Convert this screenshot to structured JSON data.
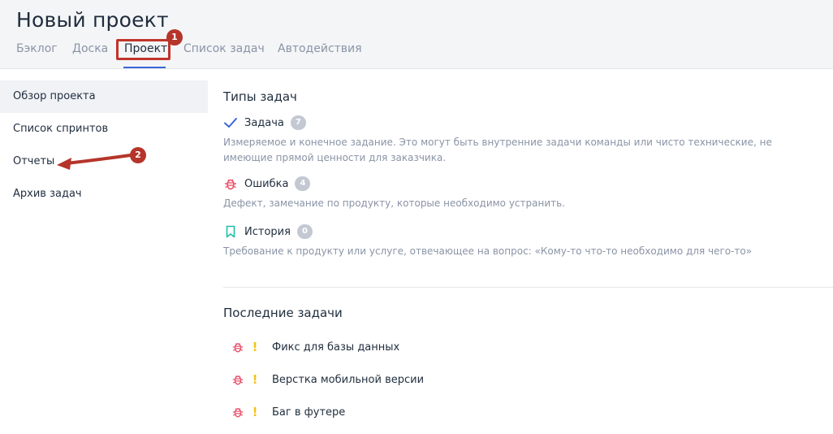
{
  "header": {
    "title": "Новый проект",
    "tabs": [
      {
        "label": "Бэклог"
      },
      {
        "label": "Доска"
      },
      {
        "label": "Проект"
      },
      {
        "label": "Список задач"
      },
      {
        "label": "Автодействия"
      }
    ],
    "active_tab": "Проект"
  },
  "sidebar": {
    "items": [
      {
        "label": "Обзор проекта"
      },
      {
        "label": "Список спринтов"
      },
      {
        "label": "Отчеты"
      },
      {
        "label": "Архив задач"
      }
    ],
    "active_item": "Обзор проекта"
  },
  "task_types": {
    "title": "Типы задач",
    "items": [
      {
        "icon": "check-icon",
        "name": "Задача",
        "count": "7",
        "description": "Измеряемое и конечное задание. Это могут быть внутренние задачи команды или чисто технические, не имеющие прямой ценности для заказчика."
      },
      {
        "icon": "bug-icon",
        "name": "Ошибка",
        "count": "4",
        "description": "Дефект, замечание по продукту, которые необходимо устранить."
      },
      {
        "icon": "bookmark-icon",
        "name": "История",
        "count": "0",
        "description": "Требование к продукту или услуге, отвечающее на вопрос: «Кому-то что-то необходимо для чего-то»"
      }
    ]
  },
  "recent_tasks": {
    "title": "Последние задачи",
    "items": [
      {
        "type_icon": "bug-icon",
        "priority": "!",
        "name": "Фикс для базы данных"
      },
      {
        "type_icon": "bug-icon",
        "priority": "!",
        "name": "Верстка мобильной версии"
      },
      {
        "type_icon": "bug-icon",
        "priority": "!",
        "name": "Баг в футере"
      }
    ]
  },
  "annotations": {
    "marker_1": "1",
    "marker_2": "2"
  },
  "colors": {
    "accent": "#3a66d6",
    "annotation": "#c0342b",
    "bug": "#e8556d",
    "story": "#1fbfa6",
    "priority": "#f0c419"
  }
}
